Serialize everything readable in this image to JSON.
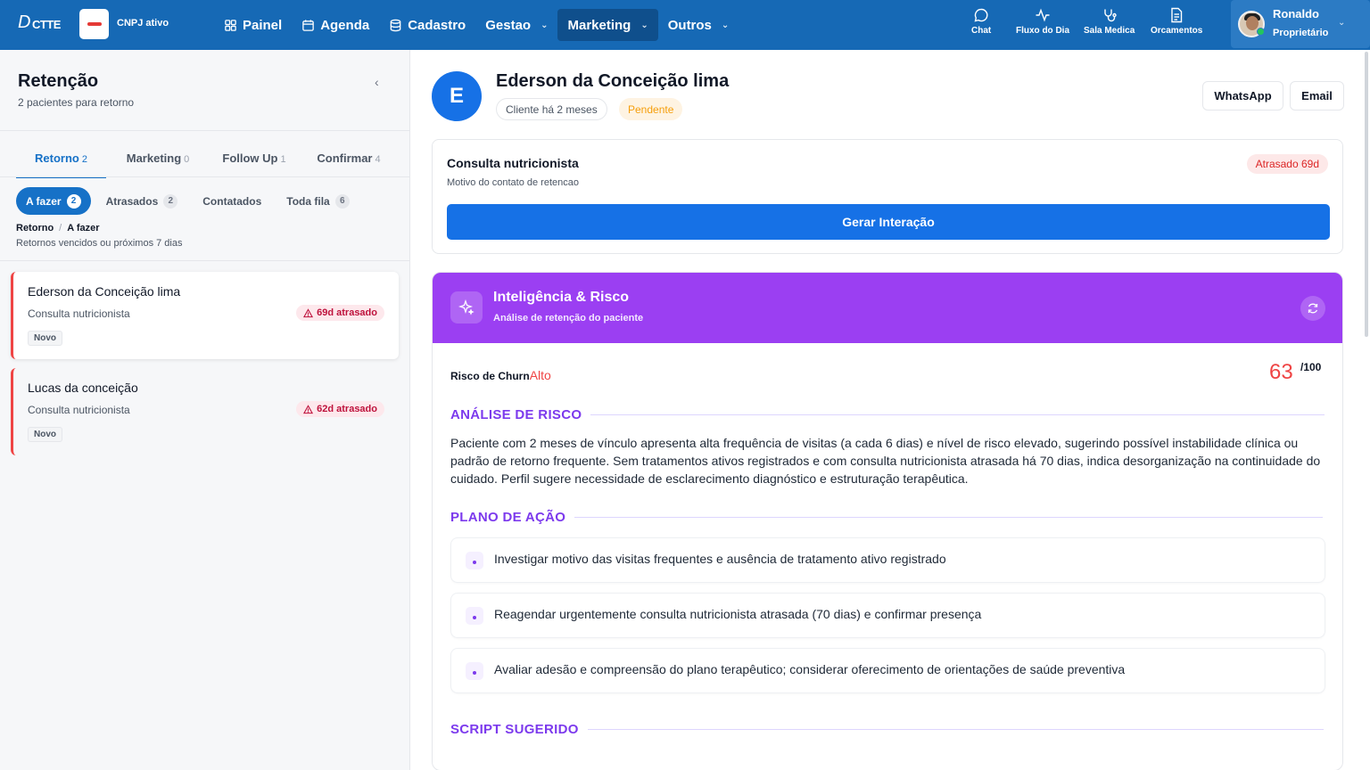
{
  "topbar": {
    "logo": "D",
    "logo_rest": "CTTE",
    "cnpj": "CNPJ ativo",
    "nav": [
      {
        "label": "Painel",
        "icon": "grid-icon"
      },
      {
        "label": "Agenda",
        "icon": "calendar-icon"
      },
      {
        "label": "Cadastro",
        "icon": "database-icon"
      },
      {
        "label": "Gestao",
        "icon": "chevron-down-icon"
      },
      {
        "label": "Marketing",
        "icon": "chevron-down-icon"
      },
      {
        "label": "Outros",
        "icon": "chevron-down-icon"
      }
    ],
    "quick": [
      {
        "label": "Chat",
        "icon": "chat-icon"
      },
      {
        "label": "Fluxo do Dia",
        "icon": "activity-icon"
      },
      {
        "label": "Sala Medica",
        "icon": "stethoscope-icon"
      },
      {
        "label": "Orcamentos",
        "icon": "document-icon"
      }
    ],
    "user": {
      "name": "Ronaldo",
      "role": "Proprietário"
    }
  },
  "left": {
    "title": "Retenção",
    "subtitle": "2 pacientes para retorno",
    "tabs": [
      {
        "label": "Retorno",
        "count": "2"
      },
      {
        "label": "Marketing",
        "count": "0"
      },
      {
        "label": "Follow Up",
        "count": "1"
      },
      {
        "label": "Confirmar",
        "count": "4"
      }
    ],
    "filters": [
      {
        "label": "A fazer",
        "count": "2"
      },
      {
        "label": "Atrasados",
        "count": "2"
      },
      {
        "label": "Contatados",
        "count": ""
      },
      {
        "label": "Toda fila",
        "count": "6"
      }
    ],
    "breadcrumb": {
      "a": "Retorno",
      "sep": "/",
      "b": "A fazer"
    },
    "breadcrumb_sub": "Retornos vencidos ou próximos 7 dias",
    "patients": [
      {
        "name": "Ederson da Conceição lima",
        "type": "Consulta nutricionista",
        "late": "69d atrasado",
        "tag": "Novo"
      },
      {
        "name": "Lucas da conceição",
        "type": "Consulta nutricionista",
        "late": "62d atrasado",
        "tag": "Novo"
      }
    ]
  },
  "detail": {
    "initial": "E",
    "name": "Ederson da Conceição lima",
    "client_since": "Cliente há 2 meses",
    "status": "Pendente",
    "whatsapp": "WhatsApp",
    "email": "Email",
    "contact": {
      "title": "Consulta nutricionista",
      "reason": "Motivo do contato de retencao",
      "late": "Atrasado 69d",
      "button": "Gerar Interação"
    },
    "ai": {
      "title": "Inteligência & Risco",
      "subtitle": "Análise de retenção do paciente",
      "churn_label": "Risco de Churn",
      "churn_level": "Alto",
      "score": "63",
      "score_max": "/100",
      "analysis_title": "ANÁLISE DE RISCO",
      "analysis": "Paciente com 2 meses de vínculo apresenta alta frequência de visitas (a cada 6 dias) e nível de risco elevado, sugerindo possível instabilidade clínica ou padrão de retorno frequente. Sem tratamentos ativos registrados e com consulta nutricionista atrasada há 70 dias, indica desorganização na continuidade do cuidado. Perfil sugere necessidade de esclarecimento diagnóstico e estruturação terapêutica.",
      "plan_title": "PLANO DE AÇÃO",
      "plan": [
        "Investigar motivo das visitas frequentes e ausência de tratamento ativo registrado",
        "Reagendar urgentemente consulta nutricionista atrasada (70 dias) e confirmar presença",
        "Avaliar adesão e compreensão do plano terapêutico; considerar oferecimento de orientações de saúde preventiva"
      ],
      "script_title": "SCRIPT SUGERIDO"
    }
  }
}
